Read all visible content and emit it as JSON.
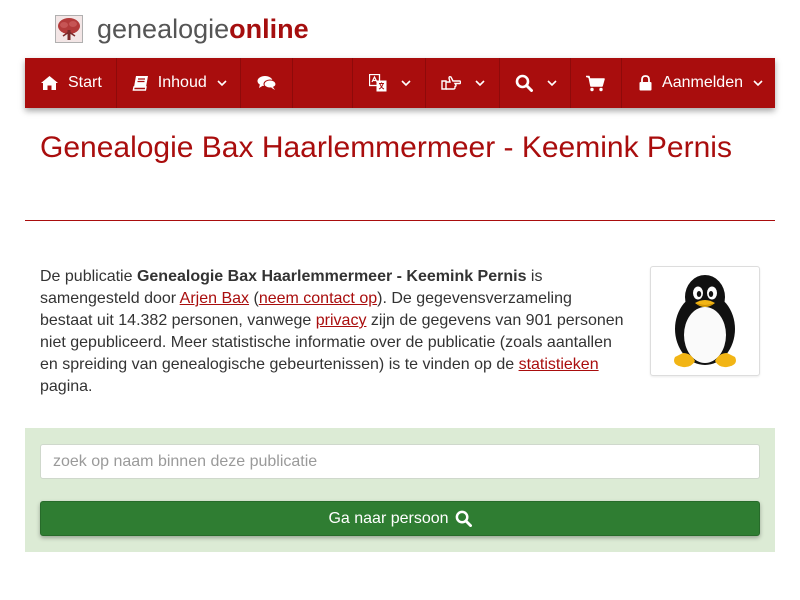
{
  "brand": {
    "part1": "genealogie",
    "part2": "online",
    "logo_icon": "tree-icon"
  },
  "nav": {
    "start_label": "Start",
    "inhoud_label": "Inhoud",
    "login_label": "Aanmelden",
    "icons": [
      "home-icon",
      "book-icon",
      "comments-icon",
      "translate-icon",
      "hand-pointer-icon",
      "search-icon",
      "cart-icon",
      "lock-icon"
    ]
  },
  "page": {
    "title": "Genealogie Bax Haarlemmermeer - Keemink Pernis"
  },
  "description": {
    "t1": "De publicatie ",
    "pub_name": "Genealogie Bax Haarlemmermeer - Keemink Pernis",
    "t2": " is samengesteld door ",
    "author_link": "Arjen Bax",
    "t3": " (",
    "contact_link": "neem contact op",
    "t4": "). De gegevensverzameling bestaat uit 14.382 personen, vanwege ",
    "privacy_link": "privacy",
    "t5": " zijn de gegevens van 901 personen niet gepubliceerd. Meer statistische informatie over de publicatie (zoals aantallen en spreiding van genealogische gebeurtenissen) is te vinden op de ",
    "stats_link": "statistieken",
    "t6": " pagina."
  },
  "search": {
    "placeholder": "zoek op naam binnen deze publicatie",
    "button_label": "Ga naar persoon"
  },
  "colors": {
    "brand_red": "#a90d0d",
    "panel_green": "#dcebd5",
    "button_green": "#2f7d32"
  }
}
